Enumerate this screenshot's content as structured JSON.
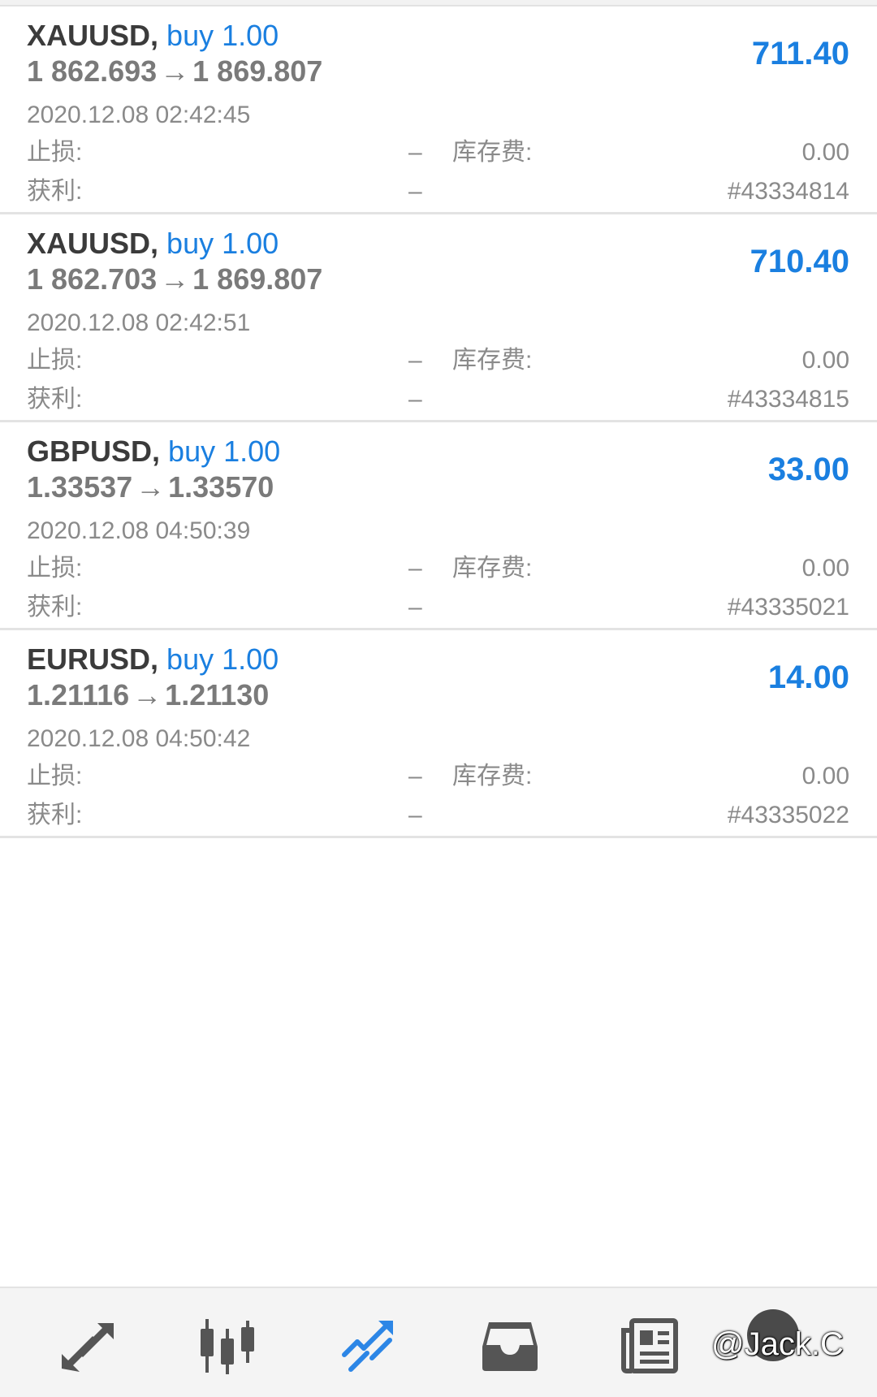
{
  "trades": [
    {
      "symbol": "XAUUSD,",
      "side": "buy 1.00",
      "open_price": "1 862.693",
      "arrow": "→",
      "current_price": "1 869.807",
      "profit": "711.40",
      "time": "2020.12.08 02:42:45",
      "sl_label": "止损:",
      "sl_value": "–",
      "swap_label": "库存费:",
      "swap_value": "0.00",
      "tp_label": "获利:",
      "tp_value": "–",
      "ticket": "#43334814"
    },
    {
      "symbol": "XAUUSD,",
      "side": "buy 1.00",
      "open_price": "1 862.703",
      "arrow": "→",
      "current_price": "1 869.807",
      "profit": "710.40",
      "time": "2020.12.08 02:42:51",
      "sl_label": "止损:",
      "sl_value": "–",
      "swap_label": "库存费:",
      "swap_value": "0.00",
      "tp_label": "获利:",
      "tp_value": "–",
      "ticket": "#43334815"
    },
    {
      "symbol": "GBPUSD,",
      "side": "buy 1.00",
      "open_price": "1.33537",
      "arrow": "→",
      "current_price": "1.33570",
      "profit": "33.00",
      "time": "2020.12.08 04:50:39",
      "sl_label": "止损:",
      "sl_value": "–",
      "swap_label": "库存费:",
      "swap_value": "0.00",
      "tp_label": "获利:",
      "tp_value": "–",
      "ticket": "#43335021"
    },
    {
      "symbol": "EURUSD,",
      "side": "buy 1.00",
      "open_price": "1.21116",
      "arrow": "→",
      "current_price": "1.21130",
      "profit": "14.00",
      "time": "2020.12.08 04:50:42",
      "sl_label": "止损:",
      "sl_value": "–",
      "swap_label": "库存费:",
      "swap_value": "0.00",
      "tp_label": "获利:",
      "tp_value": "–",
      "ticket": "#43335022"
    }
  ],
  "bottom_nav": {
    "items": [
      "quotes-icon",
      "chart-icon",
      "trade-icon",
      "history-icon",
      "news-icon",
      "settings-icon"
    ],
    "active": "trade-icon",
    "active_color": "#2c86e6",
    "inactive_color": "#555555"
  },
  "watermark": "@Jack.C",
  "colors": {
    "accent": "#1a7fe0",
    "symbol_text": "#3b3b3b",
    "muted_text": "#8a8a8a"
  }
}
